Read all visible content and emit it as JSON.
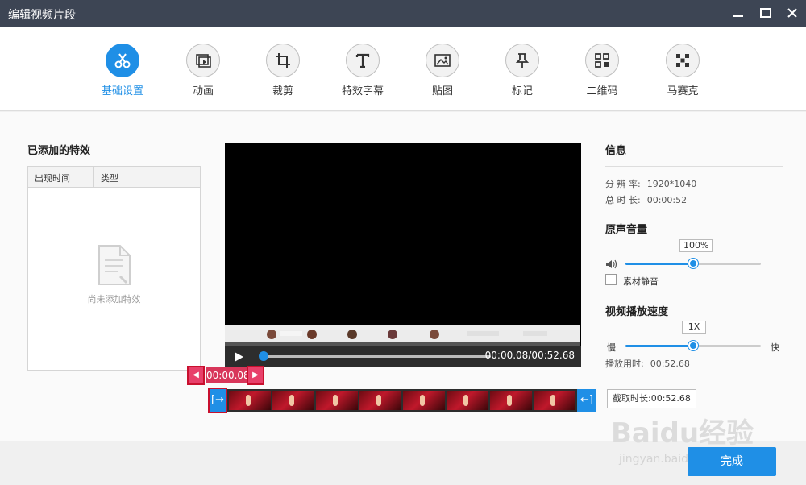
{
  "window": {
    "title": "编辑视频片段",
    "minimize_icon": "minimize-icon",
    "maximize_icon": "maximize-icon",
    "close_icon": "close-icon"
  },
  "toolbar": {
    "tools": [
      {
        "label": "基础设置",
        "icon": "scissors-icon",
        "active": true
      },
      {
        "label": "动画",
        "icon": "animation-icon",
        "active": false
      },
      {
        "label": "裁剪",
        "icon": "crop-icon",
        "active": false
      },
      {
        "label": "特效字幕",
        "icon": "text-icon",
        "active": false
      },
      {
        "label": "贴图",
        "icon": "image-icon",
        "active": false
      },
      {
        "label": "标记",
        "icon": "pin-icon",
        "active": false
      },
      {
        "label": "二维码",
        "icon": "qrcode-icon",
        "active": false
      },
      {
        "label": "马赛克",
        "icon": "mosaic-icon",
        "active": false
      }
    ],
    "accent": "#1f8fe6"
  },
  "effects": {
    "title": "已添加的特效",
    "col_time": "出现时间",
    "col_type": "类型",
    "empty_text": "尚未添加特效"
  },
  "player": {
    "time_label": "00:00.08/00:52.68",
    "progress_fraction": 0.0015
  },
  "trim": {
    "current_time": "00:00.08",
    "length_label": "截取时长:00:52.68",
    "start_handle_icon": "trim-start-icon",
    "end_handle_icon": "trim-end-icon",
    "prev_icon": "arrow-left-icon",
    "next_icon": "arrow-right-icon"
  },
  "info": {
    "title": "信息",
    "resolution_label": "分 辨 率:",
    "resolution_value": "1920*1040",
    "duration_label": "总 时 长:",
    "duration_value": "00:00:52"
  },
  "volume": {
    "title": "原声音量",
    "value_label": "100%",
    "level_fraction": 0.5,
    "mute_label": "素材静音",
    "muted": false
  },
  "speed": {
    "title": "视频播放速度",
    "value_label": "1X",
    "slow_label": "慢",
    "fast_label": "快",
    "level_fraction": 0.5,
    "play_time_label": "播放用时:",
    "play_time_value": "00:52.68"
  },
  "footer": {
    "done_label": "完成"
  },
  "watermark": {
    "text": "Baidu经验",
    "url": "jingyan.baidu.com"
  }
}
